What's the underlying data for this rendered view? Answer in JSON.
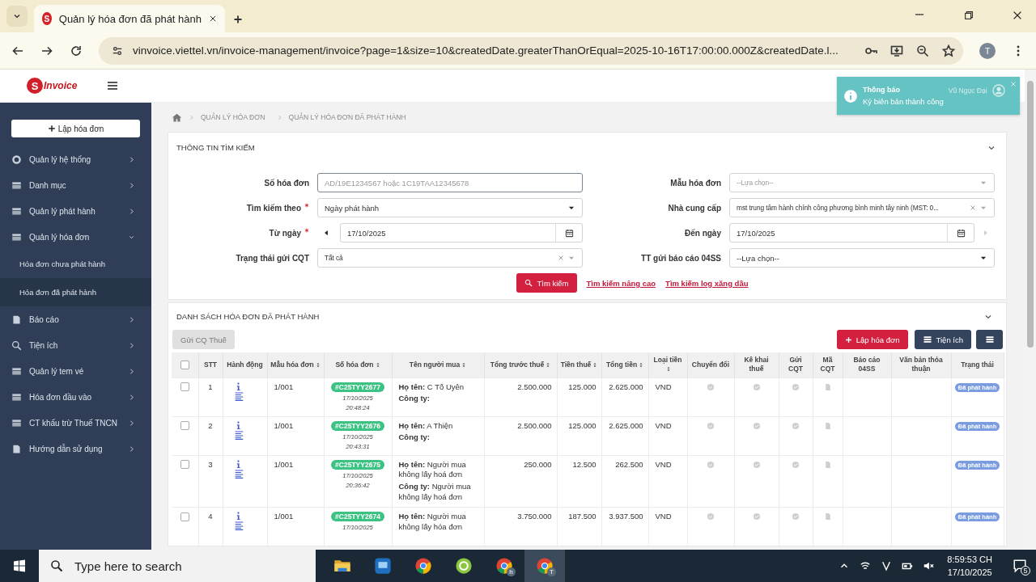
{
  "browser": {
    "tab": {
      "favicon": "S",
      "title": "Quản lý hóa đơn đã phát hành"
    },
    "url": "vinvoice.viettel.vn/invoice-management/invoice?page=1&size=10&createdDate.greaterThanOrEqual=2025-10-16T17:00:00.000Z&createdDate.l...",
    "profile": "T"
  },
  "header": {
    "logo": {
      "mark": "S",
      "text": "Invoice"
    },
    "notification": {
      "title": "Thông báo",
      "message": "Ký biên bản thành công"
    },
    "user": "Vũ Ngọc Đại"
  },
  "sidebar": {
    "create_button": "Lập hóa đơn",
    "items": [
      {
        "label": "Quản lý hệ thống",
        "kind": "gear",
        "expanded": false
      },
      {
        "label": "Danh mục",
        "kind": "card",
        "expanded": false
      },
      {
        "label": "Quản lý phát hành",
        "kind": "card",
        "expanded": false
      },
      {
        "label": "Quản lý hóa đơn",
        "kind": "card",
        "expanded": true,
        "children": [
          {
            "label": "Hóa đơn chưa phát hành",
            "selected": false
          },
          {
            "label": "Hóa đơn đã phát hành",
            "selected": true
          }
        ]
      },
      {
        "label": "Báo cáo",
        "kind": "report",
        "expanded": false
      },
      {
        "label": "Tiện ích",
        "kind": "search",
        "expanded": false
      },
      {
        "label": "Quản lý tem vé",
        "kind": "card",
        "expanded": false
      },
      {
        "label": "Hóa đơn đầu vào",
        "kind": "card",
        "expanded": false
      },
      {
        "label": "CT khấu trừ Thuế TNCN",
        "kind": "card",
        "expanded": false
      },
      {
        "label": "Hướng dẫn sử dụng",
        "kind": "report",
        "expanded": false
      }
    ]
  },
  "breadcrumb": [
    "QUẢN LÝ HÓA ĐƠN",
    "QUẢN LÝ HÓA ĐƠN ĐÃ PHÁT HÀNH"
  ],
  "search_panel": {
    "title": "THÔNG TIN TÌM KIẾM",
    "fields": [
      {
        "label": "Số hóa đơn",
        "required": false,
        "kind": "text",
        "placeholder": "AD/19E1234567 hoặc 1C19TAA12345678",
        "focused": true
      },
      {
        "label": "Mẫu hóa đơn",
        "required": false,
        "kind": "combo",
        "placeholder": "--Lựa chọn--",
        "clearable": false
      },
      {
        "label": "Tìm kiếm theo",
        "required": true,
        "kind": "select",
        "value": "Ngày phát hành"
      },
      {
        "label": "Nhà cung cấp",
        "required": false,
        "kind": "combo",
        "value": "mst trung tâm hành chính công phương bình minh tây ninh (MST: 0...",
        "clearable": true
      },
      {
        "label": "Từ ngày",
        "required": true,
        "kind": "datefrom",
        "value": "17/10/2025"
      },
      {
        "label": "Đến ngày",
        "required": false,
        "kind": "dateto",
        "value": "17/10/2025"
      },
      {
        "label": "Trạng thái gửi CQT",
        "required": false,
        "kind": "combo",
        "value": "Tất cả",
        "clearable": true
      },
      {
        "label": "TT gửi báo cáo 04SS",
        "required": false,
        "kind": "select",
        "value": "--Lựa chọn--"
      }
    ],
    "search_button": "Tìm kiếm",
    "links": [
      "Tìm kiếm nâng cao",
      "Tìm kiếm log xăng dầu"
    ]
  },
  "list_panel": {
    "title": "DANH SÁCH HÓA ĐƠN ĐÃ PHÁT HÀNH",
    "send_button": {
      "label": "Gửi CQ Thuế",
      "disabled": true
    },
    "create_button": "Lập hóa đơn",
    "utility_button": "Tiện ích",
    "table": {
      "all_checked": false,
      "columns": [
        {
          "label": "STT",
          "sortable": false
        },
        {
          "label": "Hành động",
          "sortable": false
        },
        {
          "label": "Mẫu hóa đơn",
          "sortable": true
        },
        {
          "label": "Số hóa đơn",
          "sortable": true
        },
        {
          "label": "Tên người mua",
          "sortable": true
        },
        {
          "label": "Tổng trước thuế",
          "sortable": true
        },
        {
          "label": "Tiền thuế",
          "sortable": true
        },
        {
          "label": "Tổng tiền",
          "sortable": true
        },
        {
          "label": "Loại tiền",
          "sortable": true
        },
        {
          "label": "Chuyển đổi",
          "sortable": false
        },
        {
          "label": "Kê khai thuế",
          "sortable": false
        },
        {
          "label": "Gửi CQT",
          "sortable": false
        },
        {
          "label": "Mã CQT",
          "sortable": false
        },
        {
          "label": "Báo cáo 04SS",
          "sortable": false
        },
        {
          "label": "Văn bản thỏa thuận",
          "sortable": false
        },
        {
          "label": "Trạng thái",
          "sortable": false
        }
      ],
      "rows": [
        {
          "checked": false,
          "stt": "1",
          "template": "1/001",
          "invoice_no": "#C25TYY2677",
          "date": "17/10/2025",
          "time": "20:48:24",
          "buyer": [
            {
              "label": "Họ tên:",
              "value": "C Tố Uyên"
            },
            {
              "label": "Công ty:"
            }
          ],
          "subtotal": "2.500.000",
          "tax": "125.000",
          "total": "2.625.000",
          "currency": "VND",
          "status": "Đã phát hành"
        },
        {
          "checked": false,
          "stt": "2",
          "template": "1/001",
          "invoice_no": "#C25TYY2676",
          "date": "17/10/2025",
          "time": "20:43:31",
          "buyer": [
            {
              "label": "Họ tên:",
              "value": "A Thiện"
            },
            {
              "label": "Công ty:"
            }
          ],
          "subtotal": "2.500.000",
          "tax": "125.000",
          "total": "2.625.000",
          "currency": "VND",
          "status": "Đã phát hành"
        },
        {
          "checked": false,
          "stt": "3",
          "template": "1/001",
          "invoice_no": "#C25TYY2675",
          "date": "17/10/2025",
          "time": "20:36:42",
          "buyer": [
            {
              "label": "Họ tên:",
              "value": "Người mua không lấy hoá đơn"
            },
            {
              "label": "Công ty:",
              "value": "Người mua không lấy hoá đơn"
            }
          ],
          "subtotal": "250.000",
          "tax": "12.500",
          "total": "262.500",
          "currency": "VND",
          "status": "Đã phát hành"
        },
        {
          "checked": false,
          "stt": "4",
          "template": "1/001",
          "invoice_no": "#C25TYY2674",
          "date": "17/10/2025",
          "buyer": [
            {
              "label": "Họ tên:",
              "value": "Người mua không lấy hóa đơn"
            }
          ],
          "subtotal": "3.750.000",
          "tax": "187.500",
          "total": "3.937.500",
          "currency": "VND",
          "status": "Đã phát hành"
        }
      ]
    }
  },
  "taskbar": {
    "search_placeholder": "Type here to search",
    "apps": [
      {
        "kind": "folder",
        "active": false
      },
      {
        "kind": "monitor",
        "active": false
      },
      {
        "kind": "chrome",
        "active": false
      },
      {
        "kind": "green",
        "active": false
      },
      {
        "kind": "chrome",
        "badge": "h",
        "active": false
      },
      {
        "kind": "chrome",
        "badge": "T",
        "active": true
      }
    ],
    "time": "8:59:53 CH",
    "date": "17/10/2025",
    "notifications": "5"
  }
}
